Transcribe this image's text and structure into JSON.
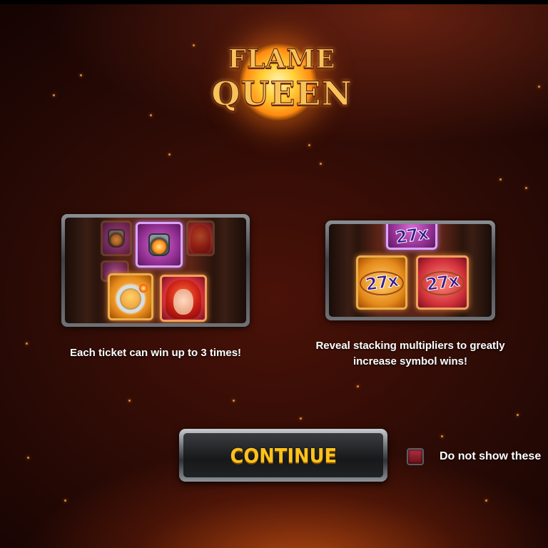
{
  "logo": {
    "line1": "FLAME",
    "line2": "QUEEN"
  },
  "features": [
    {
      "caption": "Each ticket can win up to 3 times!",
      "symbols": [
        "lantern-icon",
        "ring-icon",
        "queen-icon"
      ]
    },
    {
      "caption_line1": "Reveal stacking multipliers to greatly",
      "caption_line2": "increase symbol wins!",
      "multipliers": [
        "27x",
        "27x",
        "27x"
      ]
    }
  ],
  "continue_button": {
    "label": "CONTINUE"
  },
  "dont_show": {
    "label": "Do not show these"
  },
  "colors": {
    "button_text": "#ffc21c",
    "logo_gold": "#f6c35a",
    "background": "#2a0a05"
  }
}
